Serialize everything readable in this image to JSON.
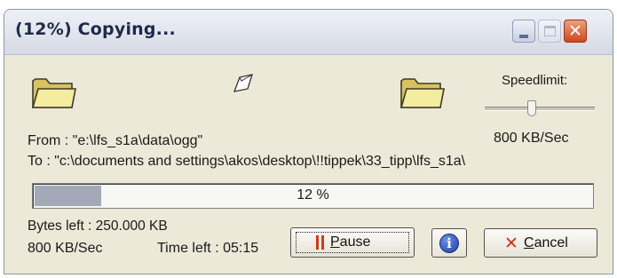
{
  "window": {
    "title": "(12%) Copying...",
    "controls": {
      "minimize": "minimize",
      "maximize": "maximize",
      "close": "close"
    }
  },
  "icons": {
    "source_folder": "folder-icon",
    "destination_folder": "folder-icon",
    "flying_document": "document-icon",
    "info": "info-icon",
    "pause": "pause-icon",
    "cancel": "cancel-x-icon"
  },
  "speed": {
    "label": "Speedlimit:",
    "slider_level": 0.43,
    "value": "800 KB/Sec"
  },
  "paths": {
    "from": "From : \"e:\\lfs_s1a\\data\\ogg\"",
    "to": "To    : \"c:\\documents and settings\\akos\\desktop\\!!tippek\\33_tipp\\lfs_s1a\\"
  },
  "progress": {
    "percent": 12,
    "text": "12 %"
  },
  "stats": {
    "bytes_left": "Bytes left : 250.000 KB",
    "rate": "800 KB/Sec",
    "time_left": "Time left : 05:15"
  },
  "buttons": {
    "pause_label_accel": "P",
    "pause_label_rest": "ause",
    "info_glyph": "i",
    "cancel_label_accel": "C",
    "cancel_label_rest": "ancel"
  },
  "colors": {
    "window_bg": "#ece9d8",
    "progress_fill": "#a3a9b7",
    "close_button": "#d0471e",
    "accent_red": "#d03a1a"
  }
}
